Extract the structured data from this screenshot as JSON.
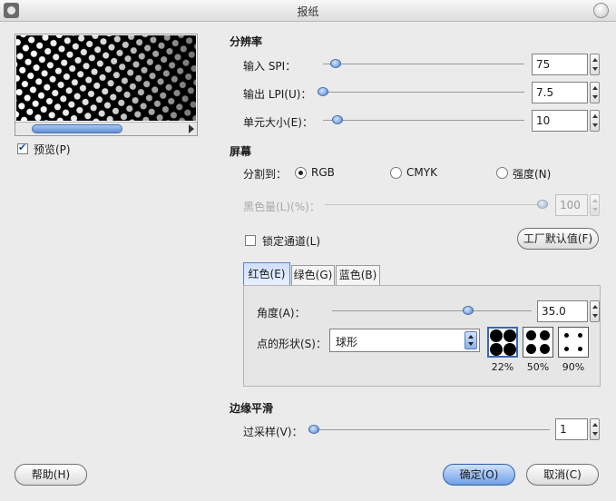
{
  "window": {
    "title": "报纸"
  },
  "preview": {
    "label": "预览(P)",
    "checked": true
  },
  "resolution": {
    "title": "分辨率",
    "input_spi": {
      "label": "输入 SPI：",
      "value": "75",
      "fraction": 0.05
    },
    "output_lpi": {
      "label": "输出 LPI(U)：",
      "value": "7.5",
      "fraction": 0.0
    },
    "cell_size": {
      "label": "单元大小(E)：",
      "value": "10",
      "fraction": 0.05
    }
  },
  "screen": {
    "title": "屏幕",
    "separate_to_label": "分割到：",
    "options": [
      "RGB",
      "CMYK",
      "强度(N)"
    ],
    "selected_option": "RGB",
    "black_pullout": {
      "label": "黑色量(L)(%)：",
      "value": "100",
      "fraction": 1.0,
      "disabled": true
    },
    "lock_channels": {
      "label": "锁定通道(L)",
      "checked": false
    },
    "factory_defaults_button": "工厂默认值(F)",
    "tabs": [
      {
        "label": "红色(E)",
        "active": true
      },
      {
        "label": "绿色(G)",
        "active": false
      },
      {
        "label": "蓝色(B)",
        "active": false
      }
    ],
    "angle": {
      "label": "角度(A)：",
      "value": "35.0",
      "fraction": 0.69
    },
    "spot_shape": {
      "label": "点的形状(S)：",
      "value": "球形"
    },
    "spot_previews": [
      "22%",
      "50%",
      "90%"
    ]
  },
  "antialiasing": {
    "title": "边缘平滑",
    "oversample": {
      "label": "过采样(V)：",
      "value": "1",
      "fraction": 0.0
    }
  },
  "footer": {
    "help_button": "帮助(H)",
    "ok_button": "确定(O)",
    "cancel_button": "取消(C)"
  },
  "colors": {
    "accent": "#5f8fd6",
    "disabled_text": "#a8a8a8"
  }
}
